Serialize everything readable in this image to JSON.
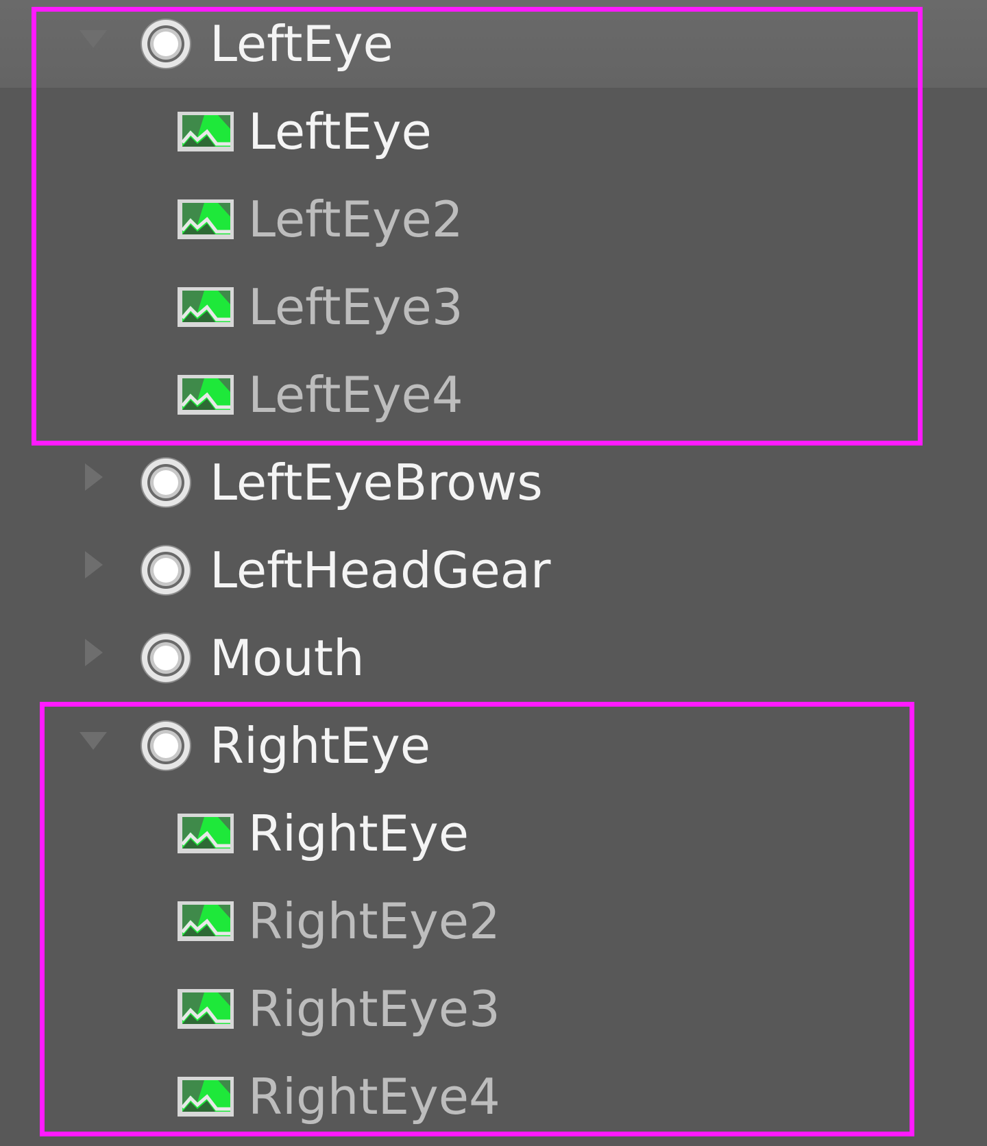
{
  "explorer": {
    "colors": {
      "background": "#585858",
      "selected_row": "#676767",
      "highlight_border": "#ff1aff",
      "icon_green": "#2fd24a"
    },
    "left_eye_group": {
      "parent": {
        "label": "LeftEye",
        "expanded": true,
        "selected": true,
        "icon": "attachment-icon"
      },
      "children": [
        {
          "label": "LeftEye",
          "icon": "decal-image-icon"
        },
        {
          "label": "LeftEye2",
          "icon": "decal-image-icon"
        },
        {
          "label": "LeftEye3",
          "icon": "decal-image-icon"
        },
        {
          "label": "LeftEye4",
          "icon": "decal-image-icon"
        }
      ]
    },
    "collapsed_nodes": [
      {
        "label": "LeftEyeBrows",
        "expanded": false,
        "icon": "attachment-icon"
      },
      {
        "label": "LeftHeadGear",
        "expanded": false,
        "icon": "attachment-icon"
      },
      {
        "label": "Mouth",
        "expanded": false,
        "icon": "attachment-icon"
      }
    ],
    "right_eye_group": {
      "parent": {
        "label": "RightEye",
        "expanded": true,
        "selected": false,
        "icon": "attachment-icon"
      },
      "children": [
        {
          "label": "RightEye",
          "icon": "decal-image-icon"
        },
        {
          "label": "RightEye2",
          "icon": "decal-image-icon"
        },
        {
          "label": "RightEye3",
          "icon": "decal-image-icon"
        },
        {
          "label": "RightEye4",
          "icon": "decal-image-icon"
        }
      ]
    }
  }
}
